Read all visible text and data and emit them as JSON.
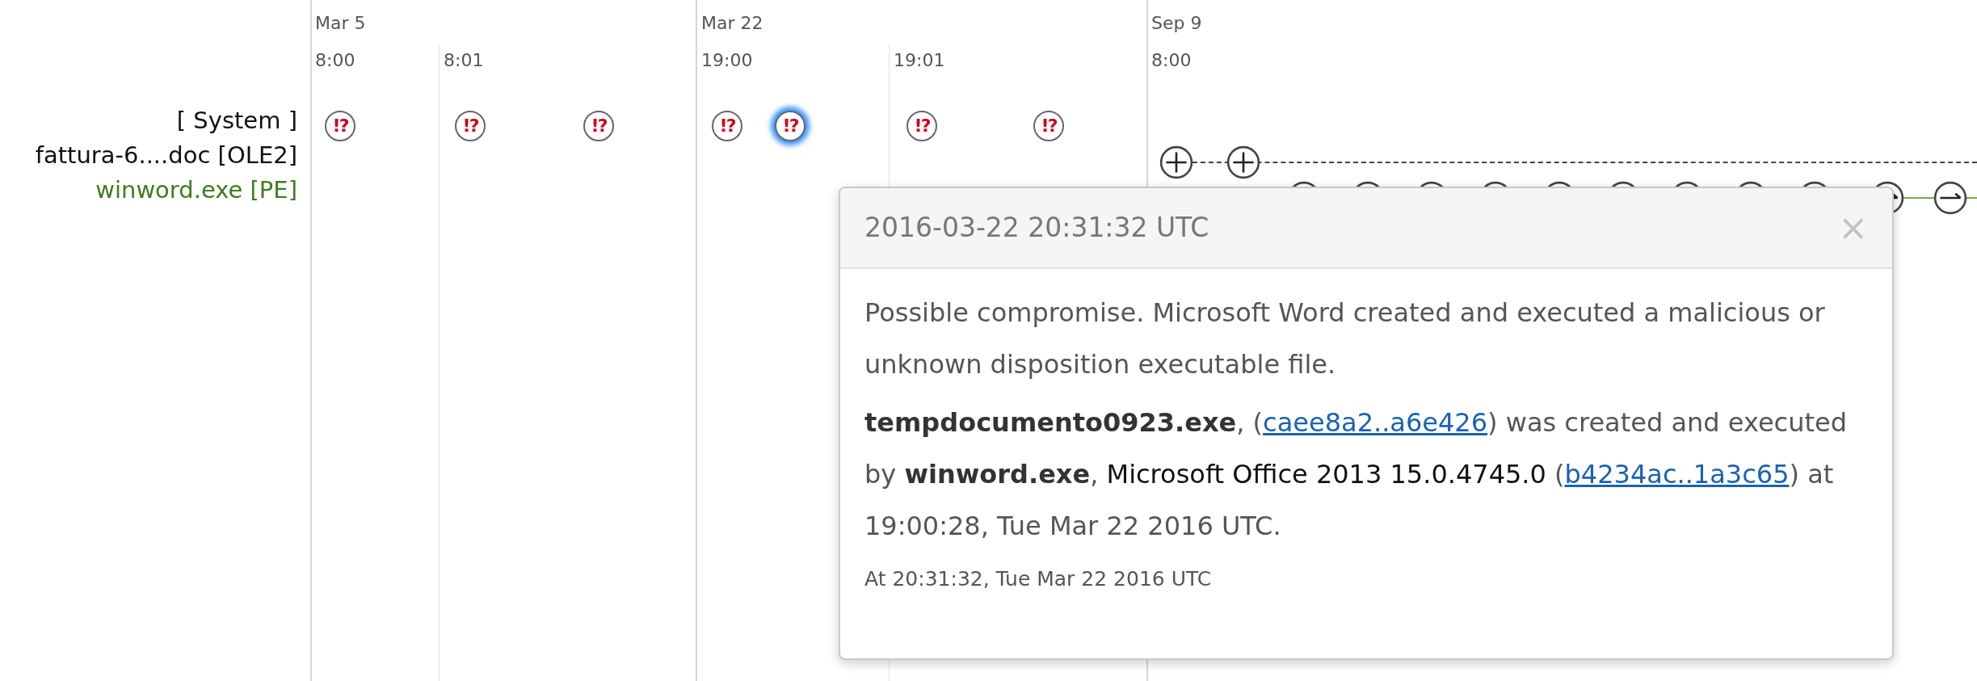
{
  "lanes": [
    {
      "label": "[ System ]",
      "kind": "system"
    },
    {
      "label": "fattura-6....doc [OLE2]",
      "kind": "document"
    },
    {
      "label": "winword.exe [PE]",
      "kind": "process"
    }
  ],
  "axis": [
    {
      "date": "Mar 5",
      "time": "8:00"
    },
    {
      "time": "8:01"
    },
    {
      "date": "Mar 22",
      "time": "19:00"
    },
    {
      "time": "19:01"
    },
    {
      "date": "Sep 9",
      "time": "8:00"
    }
  ],
  "alerts": [
    {
      "symbol": "!?",
      "selected": false
    },
    {
      "symbol": "!?",
      "selected": false
    },
    {
      "symbol": "!?",
      "selected": false
    },
    {
      "symbol": "!?",
      "selected": false
    },
    {
      "symbol": "!?",
      "selected": true
    },
    {
      "symbol": "!?",
      "selected": false
    },
    {
      "symbol": "!?",
      "selected": false
    }
  ],
  "document_events": [
    {
      "kind": "created"
    },
    {
      "kind": "created"
    }
  ],
  "process_events": [
    {
      "kind": "run"
    },
    {
      "kind": "run"
    },
    {
      "kind": "run"
    },
    {
      "kind": "run"
    },
    {
      "kind": "run"
    },
    {
      "kind": "run"
    },
    {
      "kind": "run"
    },
    {
      "kind": "run"
    },
    {
      "kind": "run"
    },
    {
      "kind": "exit"
    },
    {
      "kind": "exit"
    }
  ],
  "popover": {
    "title": "2016-03-22 20:31:32 UTC",
    "close": "×",
    "summary": "Possible compromise. Microsoft Word created and executed a malicious or unknown disposition executable file.",
    "details": [
      {
        "kind": "bold",
        "text": "tempdocumento0923.exe"
      },
      {
        "kind": "text",
        "text": ", ("
      },
      {
        "kind": "link",
        "text": "caee8a2..a6e426"
      },
      {
        "kind": "text",
        "text": ") was created and executed by "
      },
      {
        "kind": "bold",
        "text": "winword.exe"
      },
      {
        "kind": "text",
        "text": ", "
      },
      {
        "kind": "dark",
        "text": "Microsoft Office 2013 15.0.4745.0"
      },
      {
        "kind": "text",
        "text": " ("
      },
      {
        "kind": "link",
        "text": "b4234ac..1a3c65"
      },
      {
        "kind": "text",
        "text": ") at 19:00:28, Tue Mar 22 2016 UTC."
      }
    ],
    "footnote": "At 20:31:32, Tue Mar 22 2016 UTC"
  }
}
